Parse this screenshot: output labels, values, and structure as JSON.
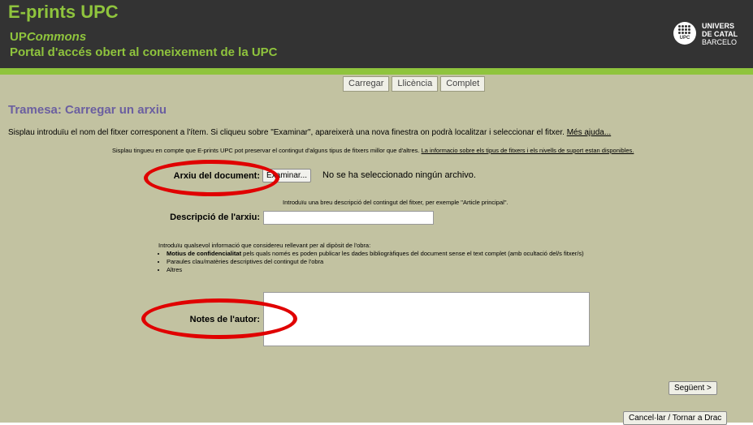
{
  "header": {
    "title": "E-prints UPC",
    "subtitle_prefix": "UP",
    "subtitle_italic": "Commons",
    "portal": "Portal d'accés obert al coneixement de la UPC",
    "logo_text": "UPC",
    "university_lines": [
      "UNIVERS",
      "DE CATAL",
      "BARCELO"
    ]
  },
  "tabs": [
    "Carregar",
    "Llicència",
    "Complet"
  ],
  "page": {
    "heading": "Tramesa: Carregar un arxiu",
    "intro": "Sisplau introduïu el nom del fitxer corresponent a l'ítem. Si cliqueu sobre \"Examinar\", apareixerà una nova finestra on podrà localitzar i seleccionar el fitxer.",
    "help_link": "Més ajuda...",
    "note": "Sisplau tingueu en compte que E-prints UPC pot preservar el contingut d'alguns tipus de fitxers millor que d'altres.",
    "note_link": "La informacio sobre els tipus de fitxers i els nivells de suport estan disponibles."
  },
  "form": {
    "file_label": "Arxiu del document:",
    "browse_button": "Examinar...",
    "file_status": "No se ha seleccionado ningún archivo.",
    "desc_hint": "Introduïu una breu descripció del contingut del fitxer, per exemple \"Article principal\".",
    "desc_label": "Descripció de l'arxiu:",
    "desc_value": "",
    "info_intro": "Introduïu qualsevol informació que considereu rellevant per al dipòsit de l'obra:",
    "info_bold": "Motius de confidencialitat",
    "info_item1": " pels quals només es poden publicar les dades bibliogràfiques del document sense el text complet (amb ocultació del/s fitxer/s)",
    "info_item2": "Paraules clau/matèries descriptives del contingut de l'obra",
    "info_item3": "Altres",
    "notes_label": "Notes de l'autor:",
    "notes_value": ""
  },
  "buttons": {
    "next": "Següent >",
    "cancel": "Cancel·lar / Tornar a Drac"
  },
  "colors": {
    "header_bg": "#333333",
    "brand_green": "#8fc43d",
    "body_bg": "#c2c2a1",
    "heading_purple": "#6b5fa0",
    "annotation_red": "#e00000"
  }
}
